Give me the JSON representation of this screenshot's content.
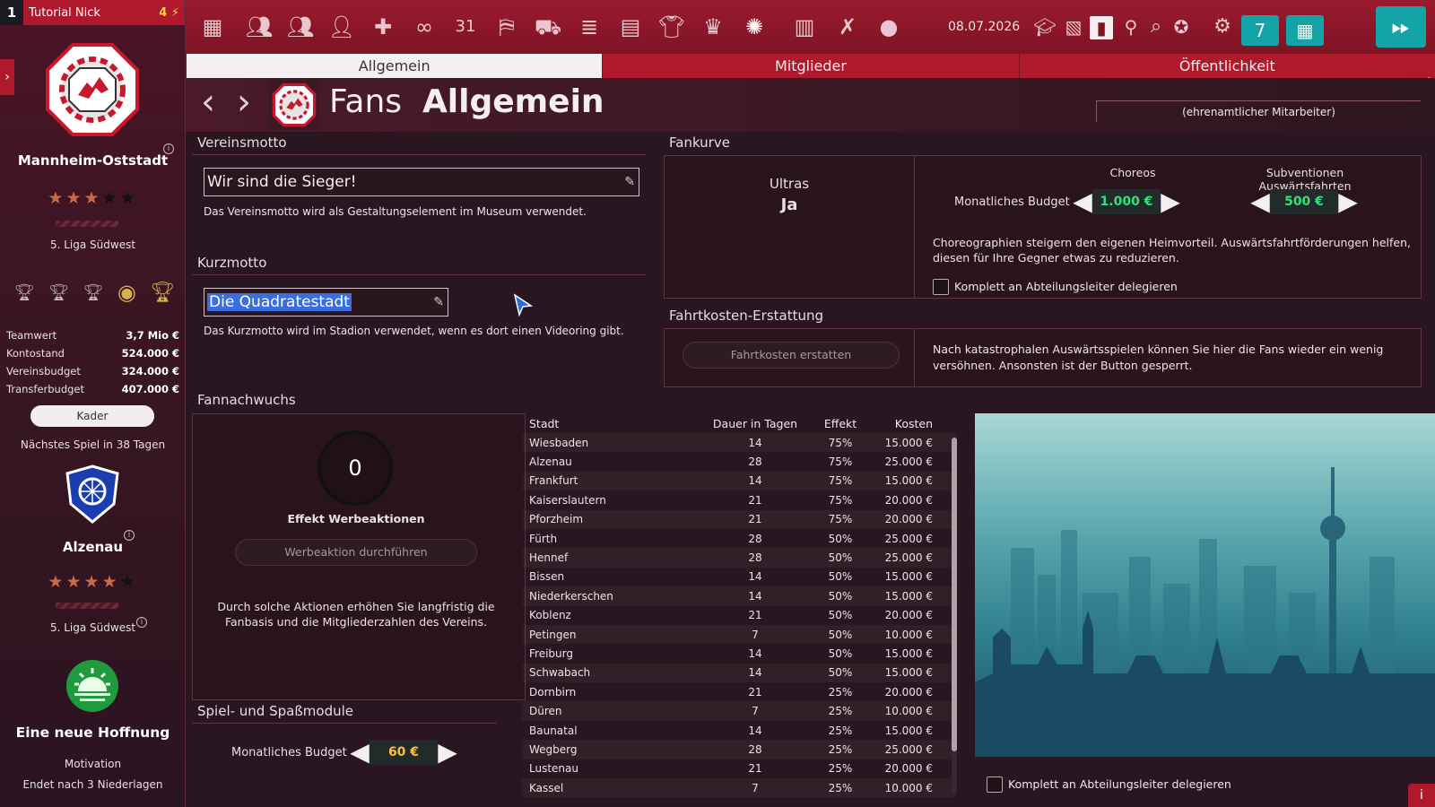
{
  "sidebar": {
    "rank": "1",
    "user": "Tutorial Nick",
    "energy": "4",
    "club_name": "Mannheim-Oststadt",
    "club_stars": "★★★★★",
    "club_league": "5. Liga Südwest",
    "finance": [
      {
        "label": "Teamwert",
        "value": "3,7 Mio €"
      },
      {
        "label": "Kontostand",
        "value": "524.000 €"
      },
      {
        "label": "Vereinsbudget",
        "value": "324.000 €"
      },
      {
        "label": "Transferbudget",
        "value": "407.000 €"
      }
    ],
    "kader_label": "Kader",
    "next_match": "Nächstes Spiel in 38 Tagen",
    "opponent_name": "Alzenau",
    "opponent_stars": "★★★★★",
    "opponent_league": "5. Liga Südwest",
    "motivation_title": "Eine neue Hoffnung",
    "motivation_label": "Motivation",
    "motivation_sub": "Endet nach 3 Niederlagen"
  },
  "topbar": {
    "date": "08.07.2026",
    "cal_day": "7"
  },
  "tabs": [
    {
      "label": "Allgemein"
    },
    {
      "label": "Mitglieder"
    },
    {
      "label": "Öffentlichkeit"
    }
  ],
  "header": {
    "title_light": "Fans",
    "title_bold": "Allgemein",
    "staff": "(ehrenamtlicher Mitarbeiter)"
  },
  "vereinsmotto": {
    "label": "Vereinsmotto",
    "value": "Wir sind die Sieger!",
    "hint": "Das Vereinsmotto wird als Gestaltungselement im Museum verwendet."
  },
  "kurzmotto": {
    "label": "Kurzmotto",
    "value": "Die Quadratestadt",
    "hint": "Das Kurzmotto wird im Stadion verwendet, wenn es dort einen Videoring gibt."
  },
  "fankurve": {
    "label": "Fankurve",
    "ultras_label": "Ultras",
    "ultras_value": "Ja",
    "choreos_label": "Choreos",
    "subventionen_label": "Subventionen Auswärtsfahrten",
    "budget_label": "Monatliches Budget",
    "choreos_value": "1.000 €",
    "subventionen_value": "500 €",
    "description": "Choreographien steigern den eigenen Heimvorteil. Auswärtsfahrtförderungen helfen, diesen für Ihre Gegner etwas zu reduzieren.",
    "delegate_label": "Komplett an Abteilungsleiter delegieren"
  },
  "fahrtkosten": {
    "label": "Fahrtkosten-Erstattung",
    "button": "Fahrtkosten erstatten",
    "description": "Nach katastrophalen Auswärtsspielen können Sie hier die Fans wieder ein wenig versöhnen. Ansonsten ist der Button gesperrt."
  },
  "fannachwuchs": {
    "label": "Fannachwuchs",
    "effect_value": "0",
    "effect_label": "Effekt Werbeaktionen",
    "button": "Werbeaktion durchführen",
    "description": "Durch solche Aktionen erhöhen Sie langfristig die Fanbasis und die Mitgliederzahlen des Vereins.",
    "columns": [
      "Stadt",
      "Dauer in Tagen",
      "Effekt",
      "Kosten"
    ],
    "rows": [
      [
        "Wiesbaden",
        "14",
        "75%",
        "15.000 €"
      ],
      [
        "Alzenau",
        "28",
        "75%",
        "25.000 €"
      ],
      [
        "Frankfurt",
        "14",
        "75%",
        "15.000 €"
      ],
      [
        "Kaiserslautern",
        "21",
        "75%",
        "20.000 €"
      ],
      [
        "Pforzheim",
        "21",
        "75%",
        "20.000 €"
      ],
      [
        "Fürth",
        "28",
        "50%",
        "25.000 €"
      ],
      [
        "Hennef",
        "28",
        "50%",
        "25.000 €"
      ],
      [
        "Bissen",
        "14",
        "50%",
        "15.000 €"
      ],
      [
        "Niederkerschen",
        "14",
        "50%",
        "15.000 €"
      ],
      [
        "Koblenz",
        "21",
        "50%",
        "20.000 €"
      ],
      [
        "Petingen",
        "7",
        "50%",
        "10.000 €"
      ],
      [
        "Freiburg",
        "14",
        "50%",
        "15.000 €"
      ],
      [
        "Schwabach",
        "14",
        "50%",
        "15.000 €"
      ],
      [
        "Dornbirn",
        "21",
        "25%",
        "20.000 €"
      ],
      [
        "Düren",
        "7",
        "25%",
        "10.000 €"
      ],
      [
        "Baunatal",
        "14",
        "25%",
        "15.000 €"
      ],
      [
        "Wegberg",
        "28",
        "25%",
        "25.000 €"
      ],
      [
        "Lustenau",
        "21",
        "25%",
        "20.000 €"
      ],
      [
        "Kassel",
        "7",
        "25%",
        "10.000 €"
      ]
    ],
    "delegate_label": "Komplett an Abteilungsleiter delegieren"
  },
  "spielmodule": {
    "label": "Spiel- und Spaßmodule",
    "budget_label": "Monatliches Budget",
    "value": "60 €"
  },
  "colors": {
    "accent_red": "#b0182c",
    "teal": "#13a4a8",
    "green_value": "#33e07a",
    "gold_value": "#ffc22e"
  }
}
